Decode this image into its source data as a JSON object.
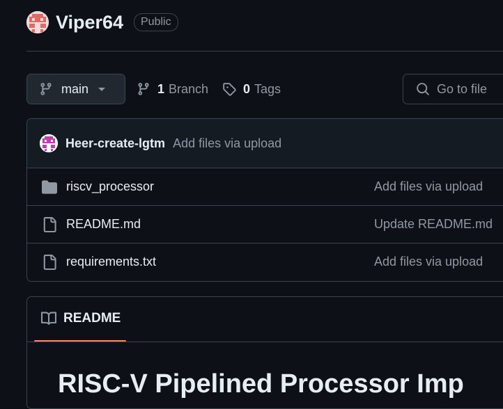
{
  "repo": {
    "name": "Viper64",
    "visibility": "Public"
  },
  "toolbar": {
    "branch": "main",
    "branch_count": "1",
    "branch_label": "Branch",
    "tag_count": "0",
    "tag_label": "Tags",
    "goto_file": "Go to file"
  },
  "commit": {
    "author": "Heer-create-lgtm",
    "message": "Add files via upload"
  },
  "files": [
    {
      "name": "riscv_processor",
      "type": "folder",
      "message": "Add files via upload"
    },
    {
      "name": "README.md",
      "type": "file",
      "message": "Update README.md"
    },
    {
      "name": "requirements.txt",
      "type": "file",
      "message": "Add files via upload"
    }
  ],
  "readme": {
    "tab": "README",
    "heading": "RISC-V Pipelined Processor Imp"
  },
  "colors": {
    "accent_underline": "#f78166",
    "background": "#0d1117",
    "border": "#3d444d"
  },
  "icons": [
    "git-branch-icon",
    "tag-icon",
    "search-icon",
    "folder-icon",
    "file-icon",
    "book-icon",
    "caret-down-icon"
  ]
}
